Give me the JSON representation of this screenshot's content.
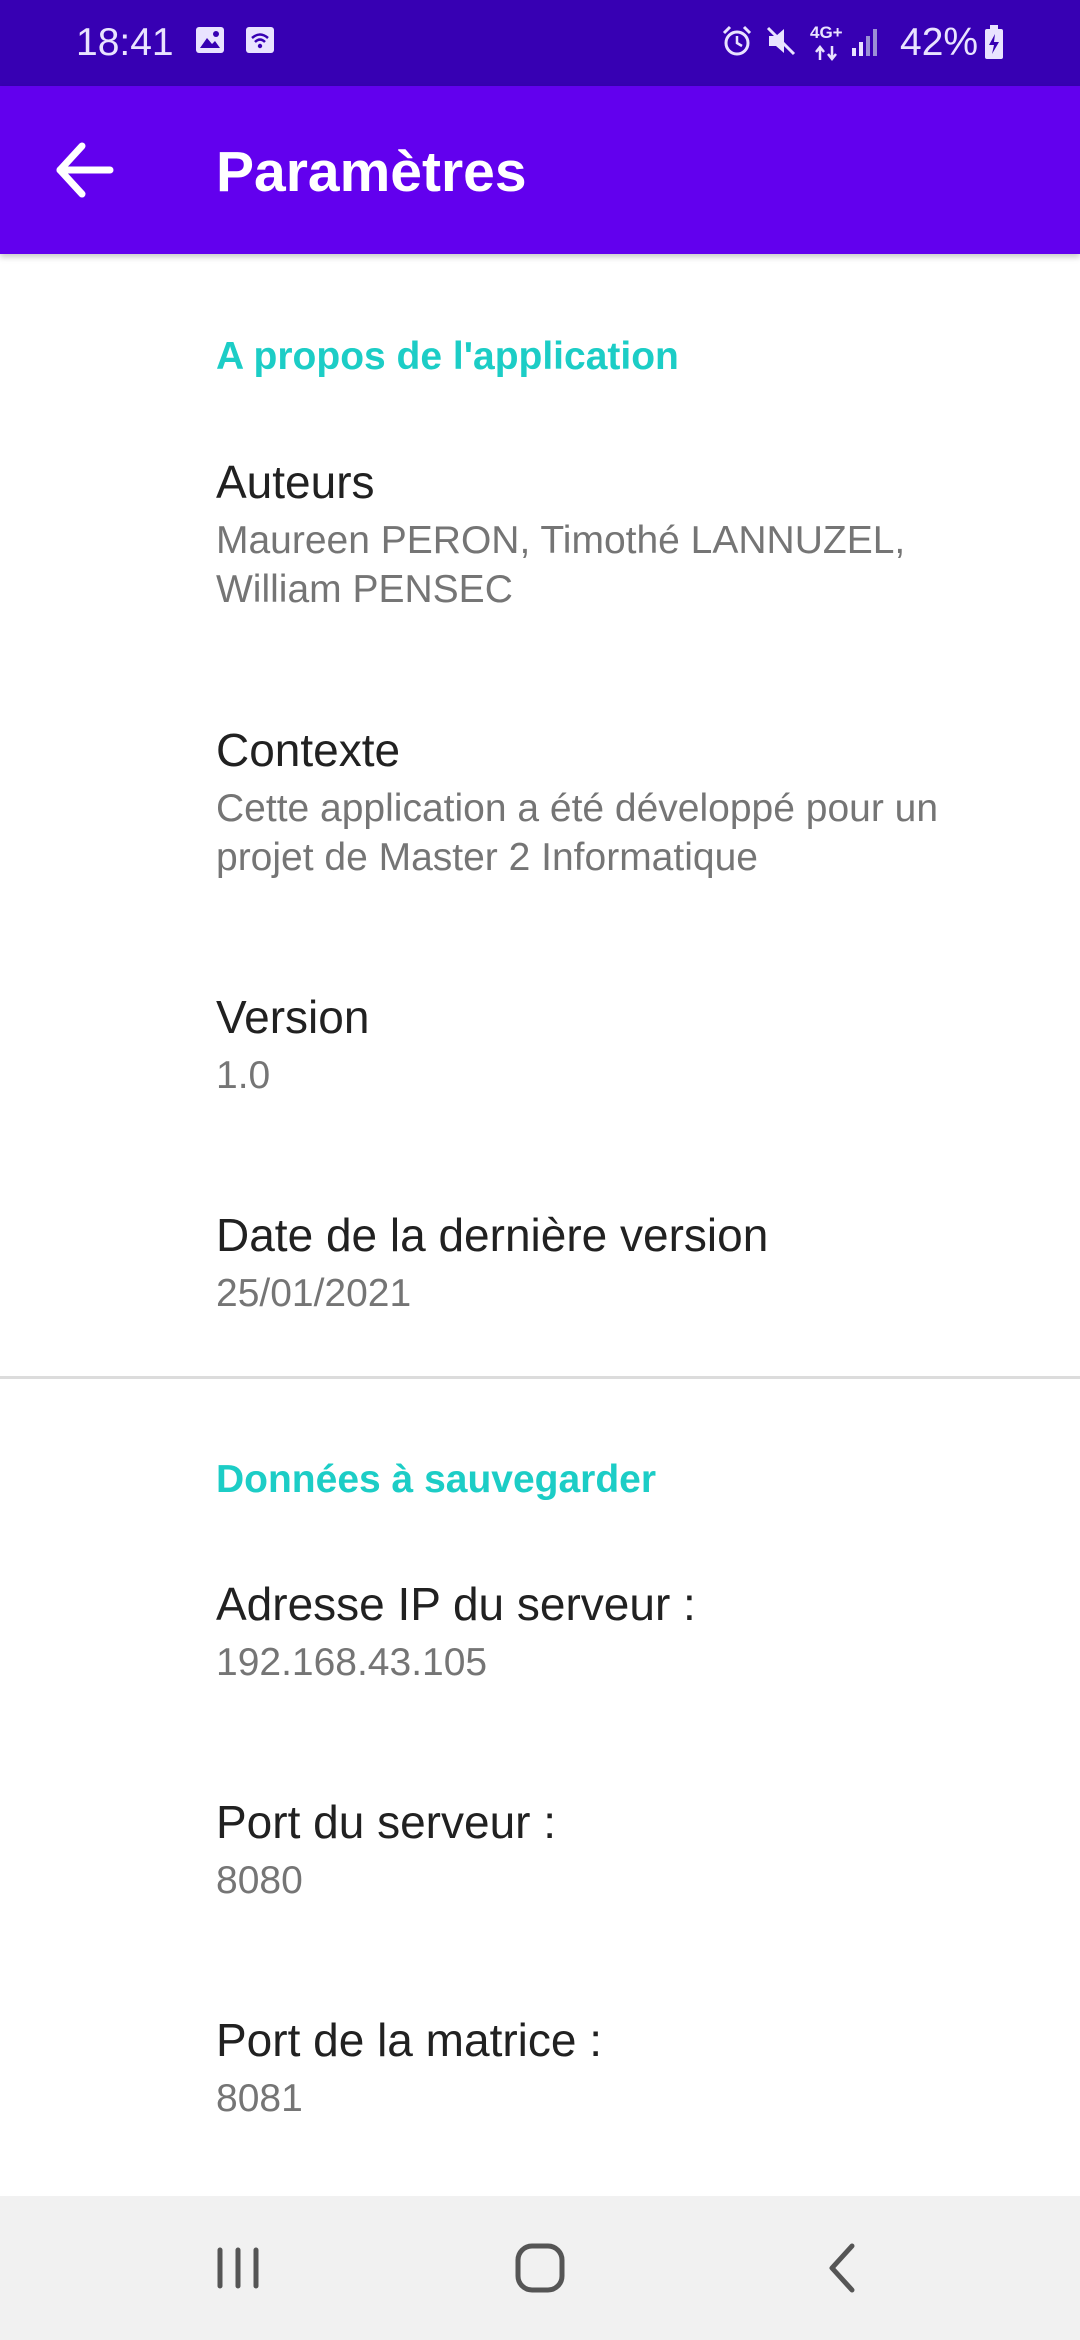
{
  "status_bar": {
    "time": "18:41",
    "network": "4G+",
    "battery": "42%"
  },
  "app_bar": {
    "title": "Paramètres",
    "back_icon": "arrow-back-icon"
  },
  "sections": [
    {
      "title": "A propos de l'application",
      "items": [
        {
          "title": "Auteurs",
          "summary": "Maureen PERON, Timothé LANNUZEL, William PENSEC"
        },
        {
          "title": "Contexte",
          "summary": "Cette application a été développé pour un projet de Master 2 Informatique"
        },
        {
          "title": "Version",
          "summary": "1.0"
        },
        {
          "title": "Date de la dernière version",
          "summary": "25/01/2021"
        }
      ]
    },
    {
      "title": "Données à sauvegarder",
      "items": [
        {
          "title": "Adresse IP du serveur :",
          "summary": "192.168.43.105"
        },
        {
          "title": "Port du serveur :",
          "summary": "8080"
        },
        {
          "title": "Port de la matrice :",
          "summary": "8081"
        }
      ]
    }
  ],
  "nav_bar": {
    "icons": [
      "recents-icon",
      "home-icon",
      "back-icon"
    ]
  },
  "colors": {
    "status_bar": "#3700b3",
    "app_bar": "#6200ee",
    "category_accent": "#1ccdc6",
    "title_text": "#212121",
    "summary_text": "#757575"
  }
}
